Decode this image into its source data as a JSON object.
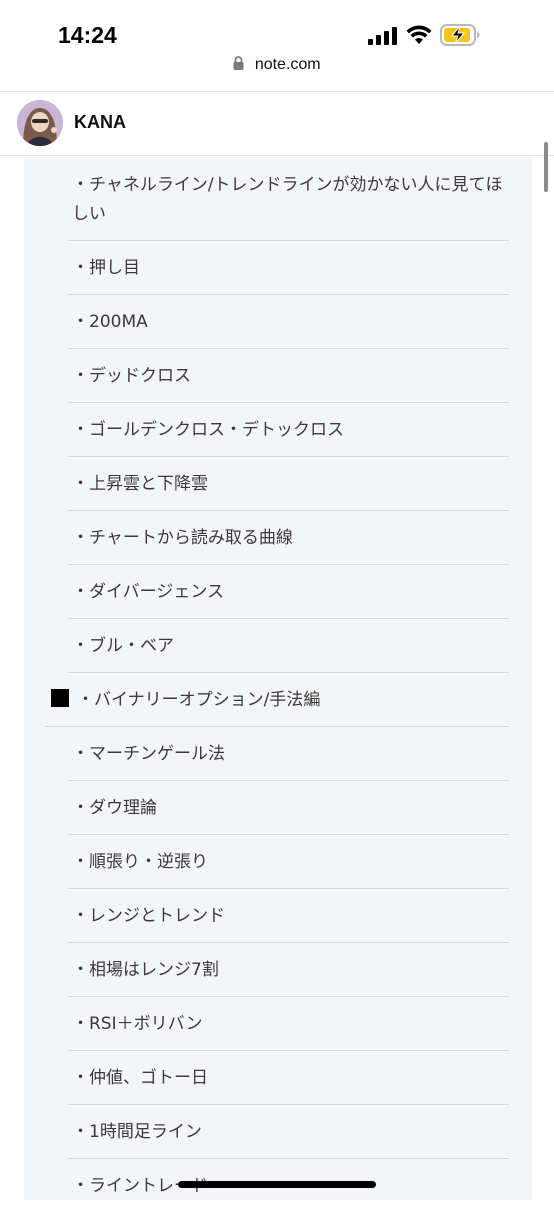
{
  "status_bar": {
    "time": "14:24"
  },
  "browser": {
    "url": "note.com"
  },
  "header": {
    "author_name": "KANA"
  },
  "toc": {
    "items": [
      {
        "text": "・チャネルライン/トレンドラインが効かない人に見てほしい"
      },
      {
        "text": "・押し目"
      },
      {
        "text": "・200MA"
      },
      {
        "text": "・デッドクロス"
      },
      {
        "text": "・ゴールデンクロス・デトックロス"
      },
      {
        "text": "・上昇雲と下降雲"
      },
      {
        "text": "・チャートから読み取る曲線"
      },
      {
        "text": "・ダイバージェンス"
      },
      {
        "text": "・ブル・ベア"
      },
      {
        "text": "・バイナリーオプション/手法編",
        "section": true
      },
      {
        "text": "・マーチンゲール法"
      },
      {
        "text": "・ダウ理論"
      },
      {
        "text": "・順張り・逆張り"
      },
      {
        "text": "・レンジとトレンド"
      },
      {
        "text": "・相場はレンジ7割"
      },
      {
        "text": "・RSI＋ボリバン"
      },
      {
        "text": "・仲値、ゴトー日"
      },
      {
        "text": "・1時間足ライン"
      },
      {
        "text": "・ライントレード"
      }
    ]
  }
}
